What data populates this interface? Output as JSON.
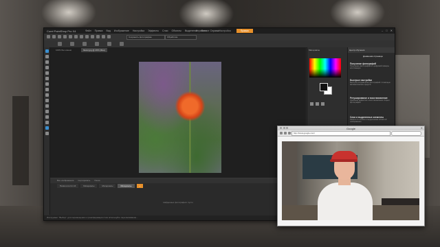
{
  "app": {
    "title": "Corel PaintShop Pro X4",
    "menu": [
      "Файл",
      "Правка",
      "Вид",
      "Изображение",
      "Настройка",
      "Эффекты",
      "Слои",
      "Объекты",
      "Выделение",
      "Окно",
      "Справка"
    ],
    "workspace_tabs": [
      "Управление",
      "Настройка",
      "Правка"
    ],
    "active_workspace": "Правка"
  },
  "toolbar": {
    "field1": "Сохранить фотографию",
    "field2": "Обработка"
  },
  "document": {
    "tab1": "100% Без имени",
    "tab2": "flower.jpg @ 20% (Фон)"
  },
  "bottom_panel": {
    "controls": [
      "Все изображения",
      "Сортировать",
      "Поиск"
    ],
    "tabs": [
      "Папки или Сл.16",
      "Материалы",
      "Материалы",
      "Материалы"
    ],
    "plus": "+",
    "message": "Найденные фотографии: пусто"
  },
  "status": "Инструмент \"Выбор\": для перемещения и трансформации слоя используйте перетаскивание...",
  "materials": {
    "title": "Материалы"
  },
  "learning": {
    "header": "Центр обучения",
    "button": "Домашняя страница",
    "items": [
      {
        "title": "Получение фотографий",
        "desc": "Получение фотографий из цифровой камеры или сканера"
      },
      {
        "title": "Быстрые настройки",
        "desc": "Быстрое исправление фотографий с помощью автоматических средств"
      },
      {
        "title": "Ретуширование и восстановление",
        "desc": "Удаление дефектов и восстановление старых фотографий"
      },
      {
        "title": "Слои и выделенные элементы",
        "desc": "Работа со слоями и выделением областей изображения"
      },
      {
        "title": "Текст и графика",
        "desc": "Добавление текста и графических элементов к фотографиям"
      },
      {
        "title": "Эффекты",
        "desc": ""
      }
    ]
  },
  "browser": {
    "title": "Google",
    "url": "http://www.google.com/"
  }
}
